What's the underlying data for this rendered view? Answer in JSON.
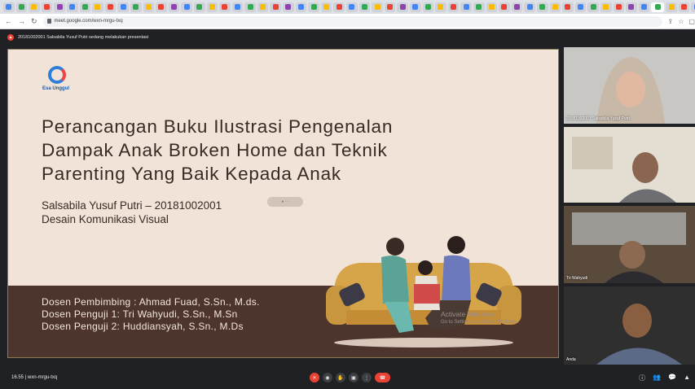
{
  "browser": {
    "url": "meet.google.com/wxn-mrgu-txq",
    "tab_colors": [
      "#4285f4",
      "#34a853",
      "#fbbc05",
      "#ea4335",
      "#8e44ad",
      "#4285f4",
      "#34a853",
      "#fbbc05",
      "#ea4335",
      "#4285f4",
      "#34a853",
      "#fbbc05",
      "#ea4335",
      "#8e44ad",
      "#4285f4",
      "#34a853",
      "#fbbc05",
      "#ea4335",
      "#4285f4",
      "#34a853",
      "#fbbc05",
      "#ea4335",
      "#8e44ad",
      "#4285f4",
      "#34a853",
      "#fbbc05",
      "#ea4335",
      "#4285f4",
      "#34a853",
      "#fbbc05",
      "#ea4335",
      "#8e44ad",
      "#4285f4",
      "#34a853",
      "#fbbc05",
      "#ea4335",
      "#4285f4",
      "#34a853",
      "#fbbc05",
      "#ea4335",
      "#8e44ad",
      "#4285f4",
      "#34a853",
      "#fbbc05",
      "#ea4335",
      "#4285f4",
      "#34a853",
      "#fbbc05",
      "#ea4335",
      "#8e44ad",
      "#4285f4",
      "#34a853",
      "#fbbc05",
      "#ea4335",
      "#4285f4",
      "#34a853"
    ],
    "new_tab_label": "+"
  },
  "meet": {
    "presenting_banner": "20181002001 Salsabila Yusuf Putri sedang melakukan presentasi",
    "meeting_info": "16.55  |  wxn-mrgu-txq"
  },
  "slide": {
    "brand": "Esa Unggul",
    "title_lines": [
      "Perancangan Buku Ilustrasi Pengenalan",
      "Dampak Anak Broken Home dan Teknik",
      "Parenting Yang Baik Kepada Anak"
    ],
    "author": "Salsabila Yusuf Putri – 20181002001",
    "program": "Desain Komunikasi Visual",
    "supervisors": [
      "Dosen Pembimbing : Ahmad Fuad, S.Sn., M.ds.",
      "Dosen Penguji 1: Tri Wahyudi, S.Sn., M.Sn",
      "Dosen Penguji 2: Huddiansyah, S.Sn., M.Ds"
    ],
    "activate_title": "Activate Windows",
    "activate_sub": "Go to Settings to activate Windows.",
    "pill_text": "● ◦ ◦"
  },
  "participants": [
    {
      "name": "20181002001 Salsabila Yusuf Putri"
    },
    {
      "name": ""
    },
    {
      "name": "Tri Wahyudi"
    },
    {
      "name": "Anda"
    }
  ],
  "controls": {
    "mic_icon": "mic-off-icon",
    "leave_icon": "phone-hangup-icon"
  }
}
